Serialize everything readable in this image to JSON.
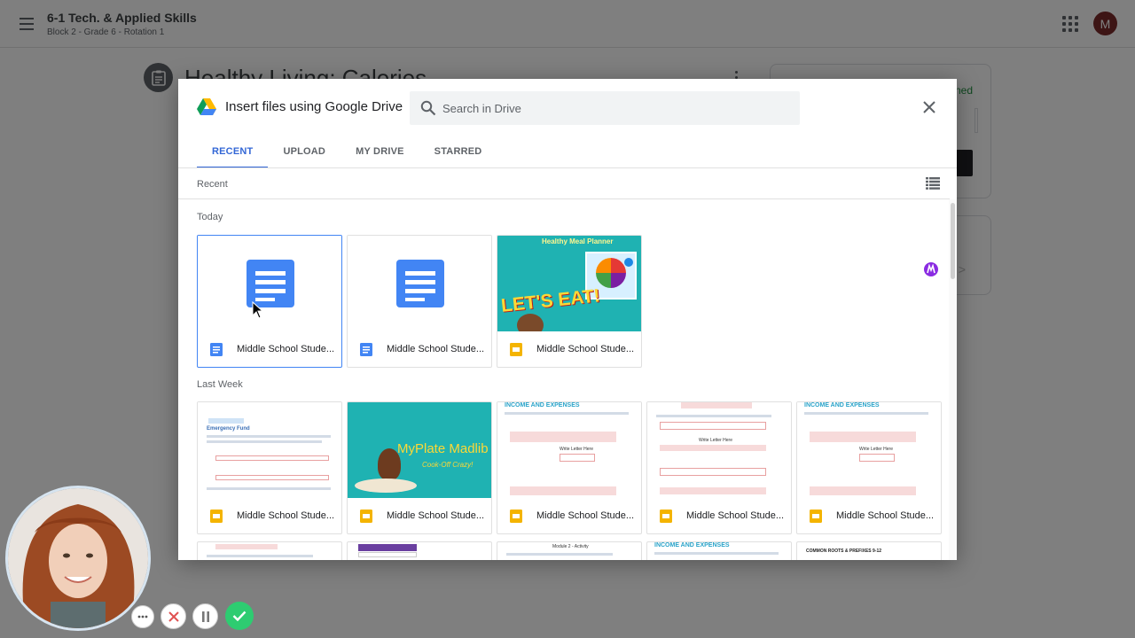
{
  "classroom": {
    "class_name": "6-1 Tech. & Applied Skills",
    "class_section": "Block 2 - Grade 6 - Rotation 1",
    "account_initial": "M",
    "assignment_title": "Healthy Living: Calories",
    "status_text": "ned"
  },
  "dialog": {
    "title": "Insert files using Google Drive",
    "search_placeholder": "Search in Drive",
    "tabs": [
      {
        "label": "RECENT",
        "active": true
      },
      {
        "label": "UPLOAD",
        "active": false
      },
      {
        "label": "MY DRIVE",
        "active": false
      },
      {
        "label": "STARRED",
        "active": false
      }
    ],
    "view_label": "Recent",
    "sections": {
      "today": "Today",
      "last_week": "Last Week"
    },
    "today_files": [
      {
        "name": "Middle School Stude...",
        "type": "docs",
        "selected": true
      },
      {
        "name": "Middle School Stude...",
        "type": "docs",
        "selected": false
      },
      {
        "name": "Middle School Stude...",
        "type": "slides",
        "selected": false,
        "thumb_heading": "Healthy Meal Planner",
        "thumb_text": "LET'S EAT!"
      }
    ],
    "last_week_files": [
      {
        "name": "Middle School Stude...",
        "type": "slides",
        "thumb_heading": "Emergency Fund"
      },
      {
        "name": "Middle School Stude...",
        "type": "slides",
        "thumb_heading": "MyPlate Madlib",
        "thumb_sub": "Cook-Off Crazy!"
      },
      {
        "name": "Middle School Stude...",
        "type": "slides",
        "thumb_heading": "INCOME AND EXPENSES",
        "thumb_note": "Write Letter Here"
      },
      {
        "name": "Middle School Stude...",
        "type": "slides",
        "thumb_heading": "",
        "thumb_note": "Write Letter Here"
      },
      {
        "name": "Middle School Stude...",
        "type": "slides",
        "thumb_heading": "INCOME AND EXPENSES",
        "thumb_note": "Write Letter Here"
      }
    ],
    "more_files": [
      {
        "thumb_heading": ""
      },
      {
        "thumb_heading": ""
      },
      {
        "thumb_heading": "Module 2 - Activity"
      },
      {
        "thumb_heading": "INCOME AND EXPENSES"
      },
      {
        "thumb_heading": "COMMON ROOTS & PREFIXES 9-12"
      }
    ]
  },
  "colors": {
    "accent": "#3367d6",
    "docs_blue": "#4285f4",
    "slides_yellow": "#f4b400",
    "record_green": "#2ecc71",
    "ext_purple": "#8a2be2"
  },
  "icons": [
    "menu-icon",
    "apps-grid-icon",
    "assignment-icon",
    "drive-logo-icon",
    "search-icon",
    "close-icon",
    "list-view-icon",
    "docs-icon",
    "slides-icon",
    "mouse-cursor-icon"
  ]
}
